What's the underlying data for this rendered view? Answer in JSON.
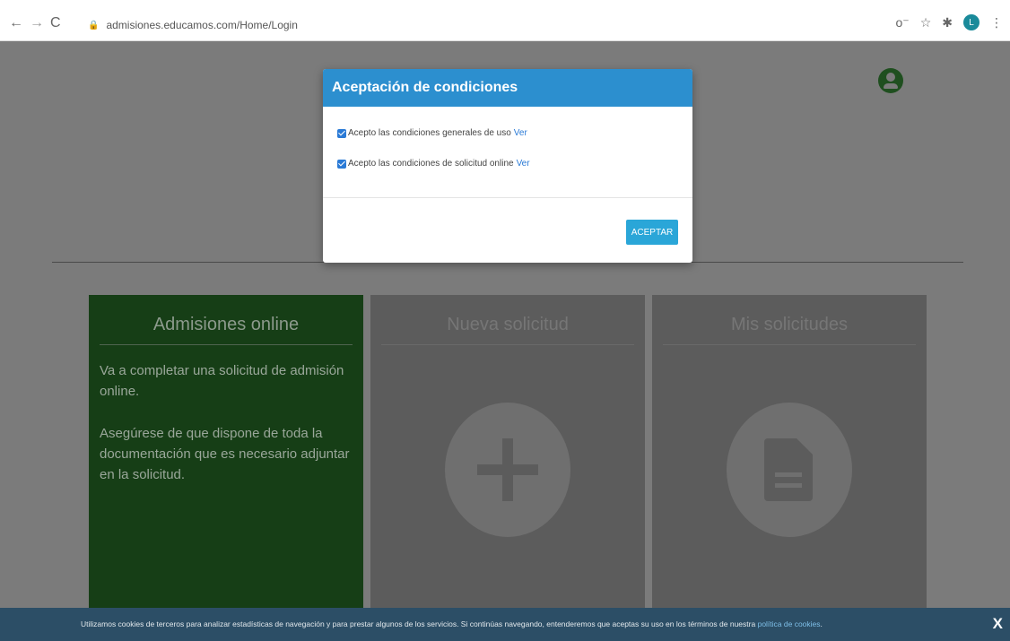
{
  "browser": {
    "url": "admisiones.educamos.com/Home/Login",
    "profile_initial": "L",
    "icons": [
      "back-icon",
      "forward-icon",
      "reload-icon",
      "lock-icon",
      "key-icon",
      "star-icon",
      "extensions-icon",
      "profile-avatar",
      "menu-icon"
    ],
    "glyphs": {
      "back": "←",
      "forward": "→",
      "reload": "C",
      "lock": "🔒",
      "key": "o⁻",
      "star": "☆",
      "extensions": "✱",
      "menu": "⋮"
    }
  },
  "modal": {
    "title": "Aceptación de condiciones",
    "checkbox1": {
      "label": "Acepto las condiciones generales de uso",
      "link": "Ver",
      "checked": true
    },
    "checkbox2": {
      "label": "Acepto las condiciones de solicitud online",
      "link": "Ver",
      "checked": true
    },
    "button": "ACEPTAR"
  },
  "cards": [
    {
      "title": "Admisiones online",
      "paragraphs": [
        "Va a completar una solicitud de admisión online.",
        "Asegúrese de que dispone de toda la documentación que es necesario adjuntar en la solicitud."
      ]
    },
    {
      "title": "Nueva solicitud",
      "icon": "plus-icon"
    },
    {
      "title": "Mis solicitudes",
      "icon": "document-icon"
    }
  ],
  "cookie_bar": {
    "text": "Utilizamos cookies de terceros para analizar estadísticas de navegación y para prestar algunos de los servicios. Si continúas navegando, entenderemos que aceptas su uso en los términos de nuestra",
    "link": "política de cookies",
    "period": ".",
    "close": "X"
  },
  "colors": {
    "overlay": "#7b7b7b",
    "modal_header": "#2c8fcf",
    "button": "#2aa6d8",
    "card_green": "#163e16",
    "card_gray": "#5c5c5c",
    "cookie_bar": "#2c4e66"
  }
}
